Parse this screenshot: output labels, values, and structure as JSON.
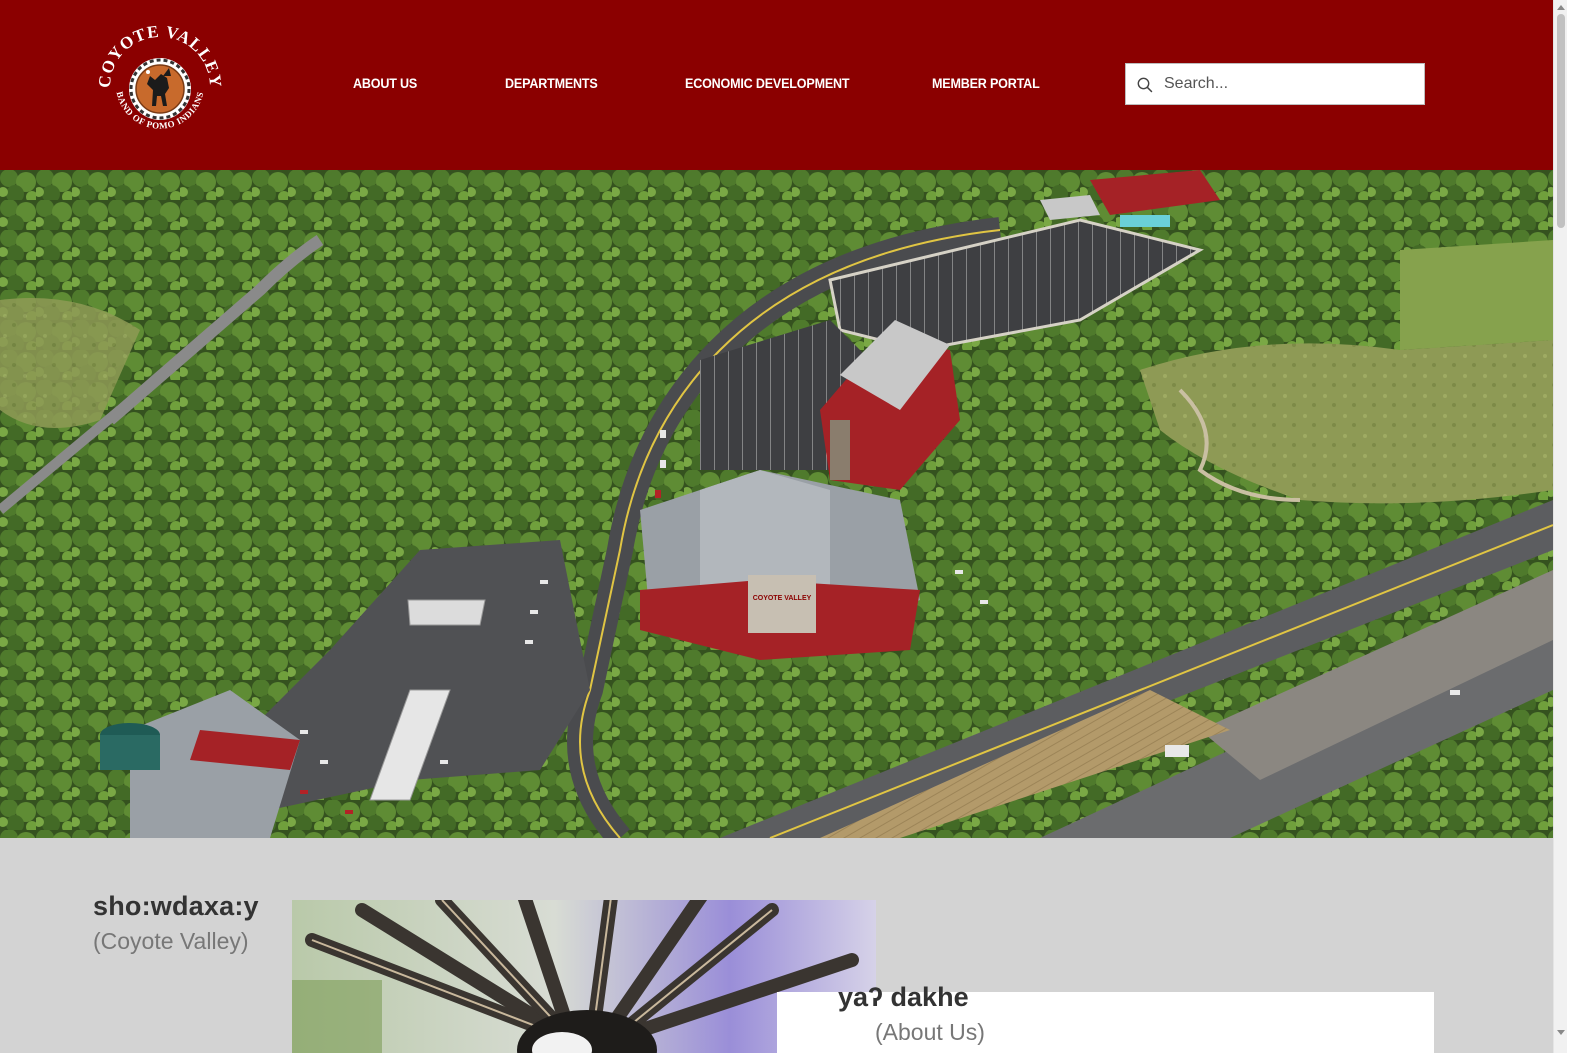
{
  "header": {
    "logo": {
      "top_text": "COYOTE VALLEY",
      "bottom_text": "BAND OF POMO INDIANS",
      "icon": "coyote-seal-icon"
    },
    "nav": [
      {
        "label": "ABOUT US"
      },
      {
        "label": "DEPARTMENTS"
      },
      {
        "label": "ECONOMIC DEVELOPMENT"
      },
      {
        "label": "MEMBER PORTAL"
      }
    ],
    "search": {
      "placeholder": "Search...",
      "value": "",
      "icon": "search-icon"
    }
  },
  "hero": {
    "image": "aerial-photo-coyote-valley-casino-resort",
    "building_sign": "COYOTE VALLEY"
  },
  "intro": {
    "title": "sho:wdaxa:y",
    "subtitle": "(Coyote Valley)"
  },
  "about": {
    "title": "yaʔ dakhe",
    "subtitle": "(About Us)"
  },
  "colors": {
    "header_bg": "#8b0000",
    "content_bg": "#d3d3d3",
    "heading_text": "#333333",
    "subheading_text": "#777777"
  }
}
